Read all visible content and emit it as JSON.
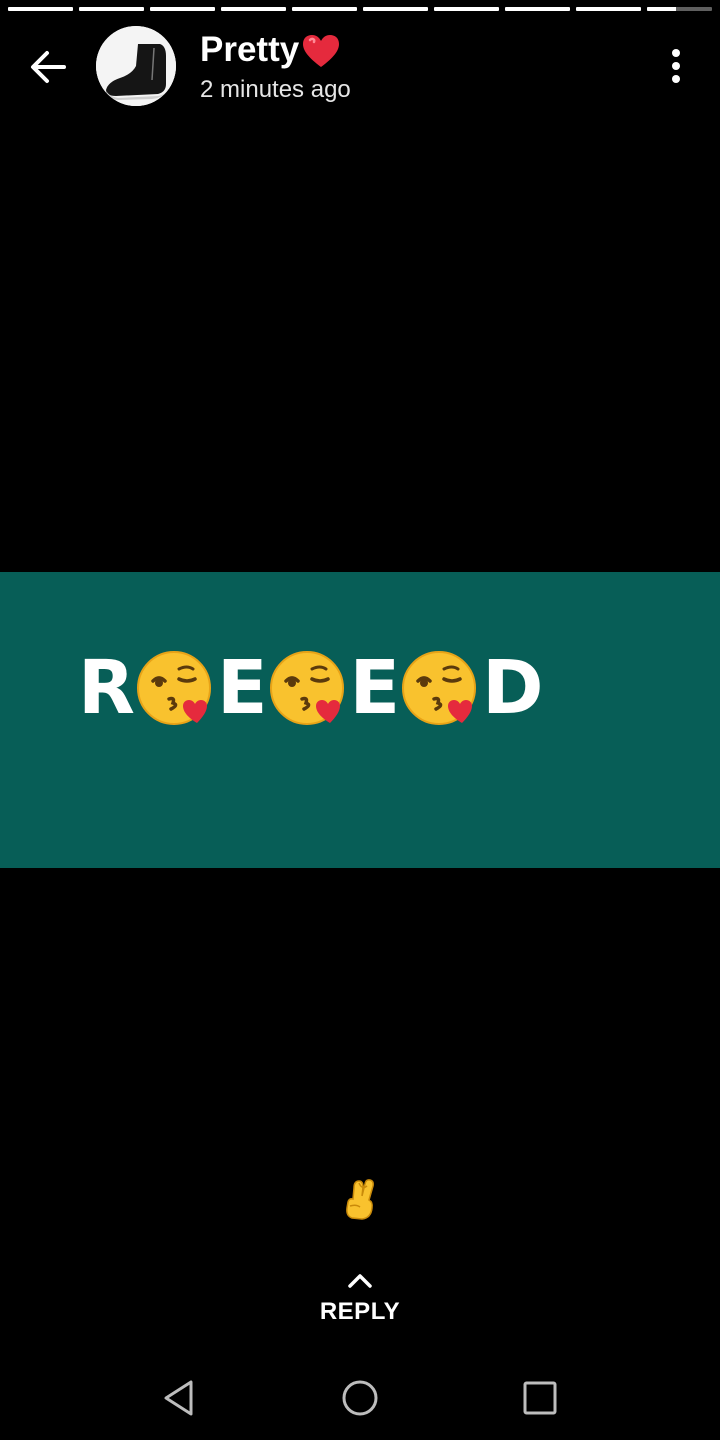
{
  "progress": {
    "segment_count": 10,
    "segments_fill": [
      1,
      1,
      1,
      1,
      1,
      1,
      1,
      1,
      1,
      0.45
    ]
  },
  "header": {
    "contact_name": "Pretty",
    "name_icon": "red-heart-icon",
    "timestamp": "2 minutes ago",
    "back_icon": "arrow-left-icon",
    "menu_icon": "more-vertical-icon",
    "avatar_icon": "black-shoe-avatar"
  },
  "story": {
    "background_color": "#075e57",
    "letters": [
      "R",
      "E",
      "E",
      "D"
    ],
    "emoji": "face-blowing-kiss-icon"
  },
  "caption": {
    "emoji": "crossed-fingers-icon"
  },
  "reply": {
    "label": "REPLY",
    "icon": "chevron-up-icon"
  },
  "navigation": {
    "back": "nav-back-icon",
    "home": "nav-home-icon",
    "recents": "nav-recents-icon"
  }
}
